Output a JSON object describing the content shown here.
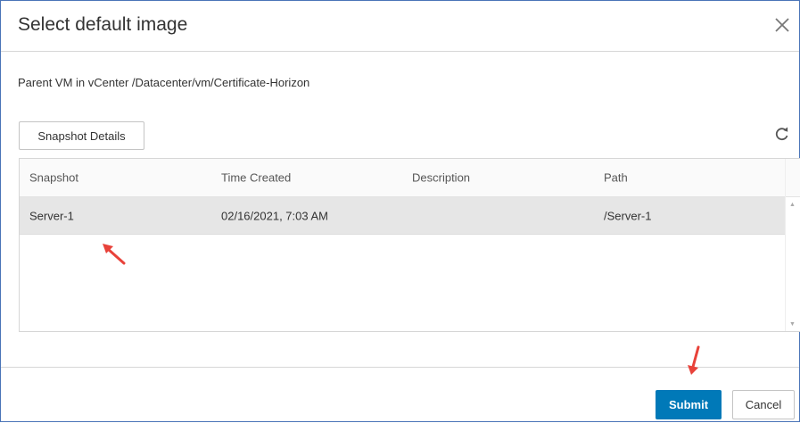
{
  "dialog": {
    "title": "Select default image",
    "subtitle": "Parent VM in vCenter /Datacenter/vm/Certificate-Horizon"
  },
  "toolbar": {
    "snapshot_details_label": "Snapshot Details"
  },
  "table": {
    "columns": [
      "Snapshot",
      "Time Created",
      "Description",
      "Path"
    ],
    "rows": [
      {
        "snapshot": "Server-1",
        "time_created": "02/16/2021, 7:03 AM",
        "description": "",
        "path": "/Server-1"
      }
    ],
    "selected_row_index": 0
  },
  "footer": {
    "submit_label": "Submit",
    "cancel_label": "Cancel"
  },
  "colors": {
    "accent": "#0079b8",
    "annotation_arrow": "#e8423a",
    "selected_row": "#e6e6e6",
    "dialog_border": "#4a74b8"
  },
  "icons": {
    "close": "close-icon",
    "refresh": "refresh-icon"
  }
}
